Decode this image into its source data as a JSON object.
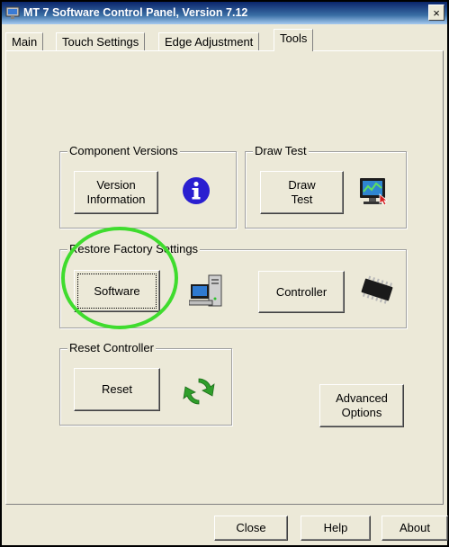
{
  "window": {
    "title": "MT 7 Software Control Panel, Version 7.12",
    "close_glyph": "×"
  },
  "tabs": [
    "Main",
    "Touch Settings",
    "Edge Adjustment",
    "Tools"
  ],
  "active_tab": "Tools",
  "groups": {
    "component_versions": {
      "legend": "Component Versions",
      "button_line1": "Version",
      "button_line2": "Information",
      "icon": "info-icon"
    },
    "draw_test": {
      "legend": "Draw Test",
      "button_line1": "Draw",
      "button_line2": "Test",
      "icon": "monitor-touch-icon"
    },
    "restore_factory_settings": {
      "legend": "Restore Factory Settings",
      "software_label": "Software",
      "controller_label": "Controller",
      "software_icon": "computer-icon",
      "controller_icon": "chip-icon"
    },
    "reset_controller": {
      "legend": "Reset Controller",
      "button_label": "Reset",
      "icon": "refresh-arrows-icon"
    }
  },
  "advanced_options": {
    "line1": "Advanced",
    "line2": "Options"
  },
  "footer": {
    "close_label": "Close",
    "help_label": "Help",
    "about_label": "About"
  },
  "colors": {
    "window_bg": "#ece9d8",
    "highlight_circle": "#3fdc2e",
    "info_icon": "#2a1fd0",
    "refresh_icon": "#2f9e2a"
  }
}
